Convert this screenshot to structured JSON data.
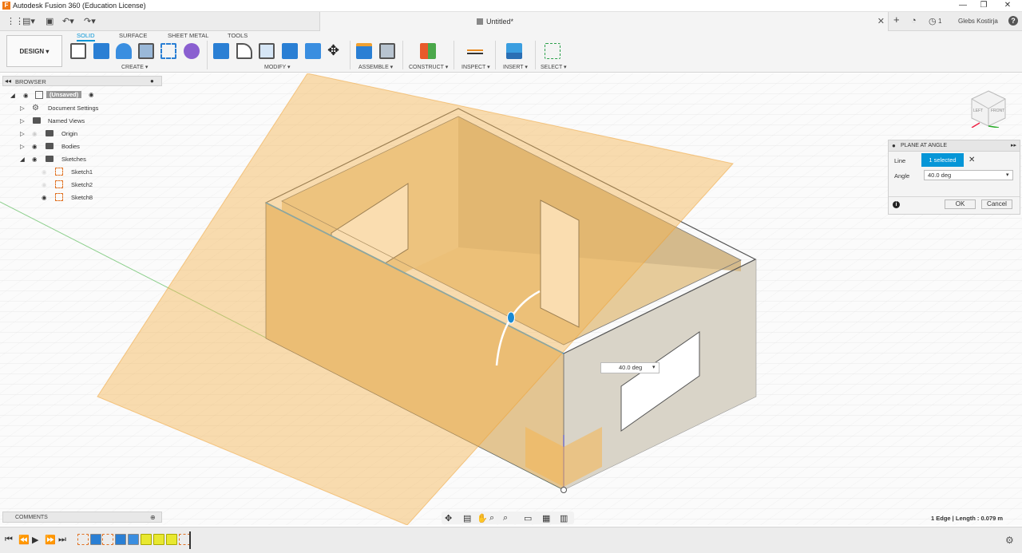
{
  "app": {
    "title": "Autodesk Fusion 360 (Education License)",
    "logo_letter": "F"
  },
  "window": {
    "minimize": "—",
    "restore": "❐",
    "close": "✕"
  },
  "quick_access": {
    "file_icon": "▤▾",
    "save_icon": "▣",
    "undo_icon": "↶▾",
    "redo_icon": "↷▾"
  },
  "document": {
    "tab_title": "Untitled*",
    "close": "✕"
  },
  "account": {
    "plus": "+",
    "jobs_count": "1",
    "user_name": "Glebs Kostirja",
    "help": "?"
  },
  "workspace": {
    "label": "DESIGN ▾"
  },
  "ribbon": {
    "tabs": [
      "SOLID",
      "SURFACE",
      "SHEET METAL",
      "TOOLS"
    ],
    "groups": [
      "CREATE ▾",
      "MODIFY ▾",
      "ASSEMBLE ▾",
      "CONSTRUCT ▾",
      "INSPECT ▾",
      "INSERT ▾",
      "SELECT ▾"
    ]
  },
  "browser": {
    "title": "BROWSER",
    "items": [
      {
        "label": "(Unsaved)"
      },
      {
        "label": "Document Settings"
      },
      {
        "label": "Named Views"
      },
      {
        "label": "Origin"
      },
      {
        "label": "Bodies"
      },
      {
        "label": "Sketches"
      },
      {
        "label": "Sketch1"
      },
      {
        "label": "Sketch2"
      },
      {
        "label": "Sketch8"
      }
    ]
  },
  "comments": {
    "title": "COMMENTS"
  },
  "viewcube": {
    "left": "LEFT",
    "front": "FRONT"
  },
  "panel": {
    "title": "PLANE AT ANGLE",
    "line_label": "Line",
    "selected": "1 selected",
    "clear": "✕",
    "angle_label": "Angle",
    "angle_value": "40.0 deg",
    "ok": "OK",
    "cancel": "Cancel",
    "info": "i"
  },
  "canvas_input": {
    "value": "40.0 deg"
  },
  "status": {
    "text": "1 Edge | Length : 0.079 m"
  },
  "colors": {
    "accent": "#0696d7",
    "plane": "#f5b450",
    "wood": "#e3c592",
    "wall": "#d9d4c8"
  }
}
